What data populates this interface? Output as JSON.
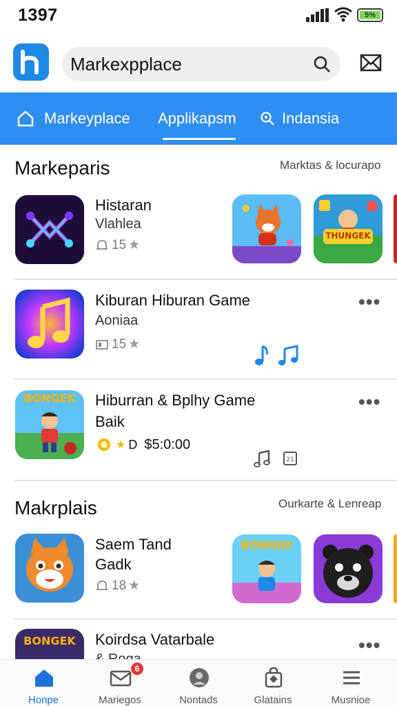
{
  "status": {
    "time": "1397",
    "battery": "5%"
  },
  "header": {
    "search_value": "Markexpplace"
  },
  "tabs": [
    {
      "label": "Markeyplace"
    },
    {
      "label": "Applikapsm"
    },
    {
      "label": "Indansia"
    }
  ],
  "sections": [
    {
      "title": "Markeparis",
      "link": "Marktas & locurapo"
    },
    {
      "title": "Makrplais",
      "link": "Ourkarte & Lenreap"
    }
  ],
  "apps": [
    {
      "title": "Histaran",
      "subtitle": "Vlahlea",
      "rating": "15"
    },
    {
      "title": "Kiburan Hiburan Game",
      "subtitle": "Aoniaa",
      "rating": "15"
    },
    {
      "title": "Hiburran & Bplhy Game",
      "subtitle": "Baik",
      "rating_prefix": "D",
      "price": "$5:0:00"
    },
    {
      "title": "Saem Tand",
      "subtitle": "Gadk",
      "rating": "18"
    },
    {
      "title": "Koirdsa Vatarbale",
      "subtitle": "& Roqa"
    }
  ],
  "thumbs": {
    "a": "BONGEK",
    "b": "THUNGEK",
    "c": "BONGEK",
    "d": "BONGEK"
  },
  "bottom_nav": [
    {
      "label": "Honpe"
    },
    {
      "label": "Mariegos",
      "badge": "6"
    },
    {
      "label": "Nontads"
    },
    {
      "label": "Glatains"
    },
    {
      "label": "Musnioe"
    }
  ],
  "colors": {
    "accent": "#2f8ef2",
    "brand": "#1e88e5",
    "badge": "#e53935"
  }
}
